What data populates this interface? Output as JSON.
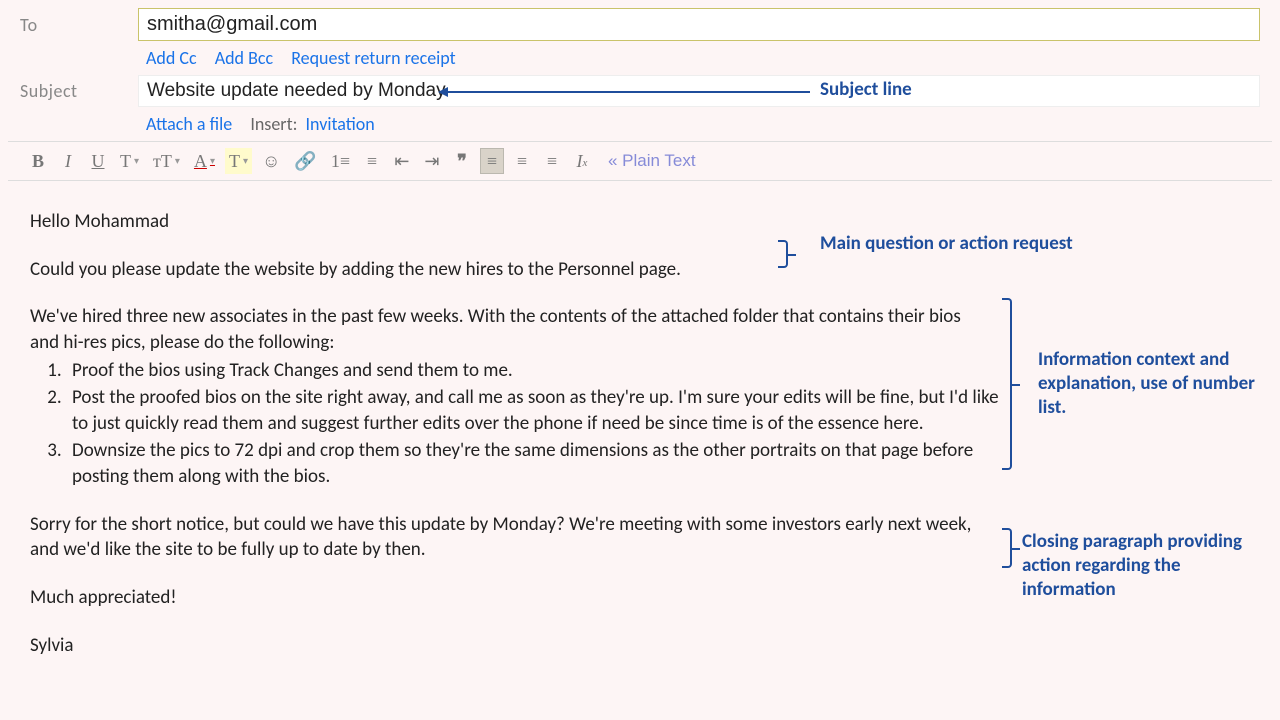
{
  "header": {
    "to_label": "To",
    "to_value": "smitha@gmail.com",
    "add_cc": "Add Cc",
    "add_bcc": "Add Bcc",
    "request_receipt": "Request return receipt",
    "subject_label": "Subject",
    "subject_value": "Website update needed by Monday",
    "attach_file": "Attach a file",
    "insert_label": "Insert:",
    "invitation": "Invitation"
  },
  "toolbar": {
    "bold": "B",
    "italic": "I",
    "underline": "U",
    "size1": "T",
    "size2": "тT",
    "color": "A",
    "bgcolor": "T",
    "emoji": "☺",
    "link": "🔗",
    "numlist": "1≡",
    "bullist": "≡",
    "indent_less": "⇤",
    "indent_more": "⇥",
    "quote": "❞",
    "align_left": "≡",
    "align_center": "≡",
    "align_right": "≡",
    "clear": "Iₓ",
    "plain": "« Plain Text"
  },
  "body": {
    "greeting": "Hello Mohammad",
    "main_request": "Could you please update the website by adding the new hires to the Personnel page.",
    "context_intro": "We've hired three new associates in the past few weeks. With the contents of the attached folder that contains their bios and hi-res pics, please do the following:",
    "steps": [
      "Proof the bios using Track Changes and send them to me.",
      "Post the proofed bios on the site right away, and call me as soon as they're up. I'm sure your edits will be fine, but I'd like to just quickly read them and suggest further edits over the phone if need be since time is of the essence here.",
      "Downsize the pics to 72 dpi and crop them so they're the same dimensions as the other portraits on that page before posting them along with the bios."
    ],
    "closing": "Sorry for the short notice, but could we have this update by Monday? We're meeting with some investors early next week, and we'd like the site to be fully up to date by then.",
    "thanks": "Much appreciated!",
    "signature": "Sylvia"
  },
  "annotations": {
    "subject": "Subject line",
    "main": "Main question or action request",
    "context": "Information context and explanation, use of number list.",
    "closing": "Closing paragraph providing action regarding the information"
  }
}
